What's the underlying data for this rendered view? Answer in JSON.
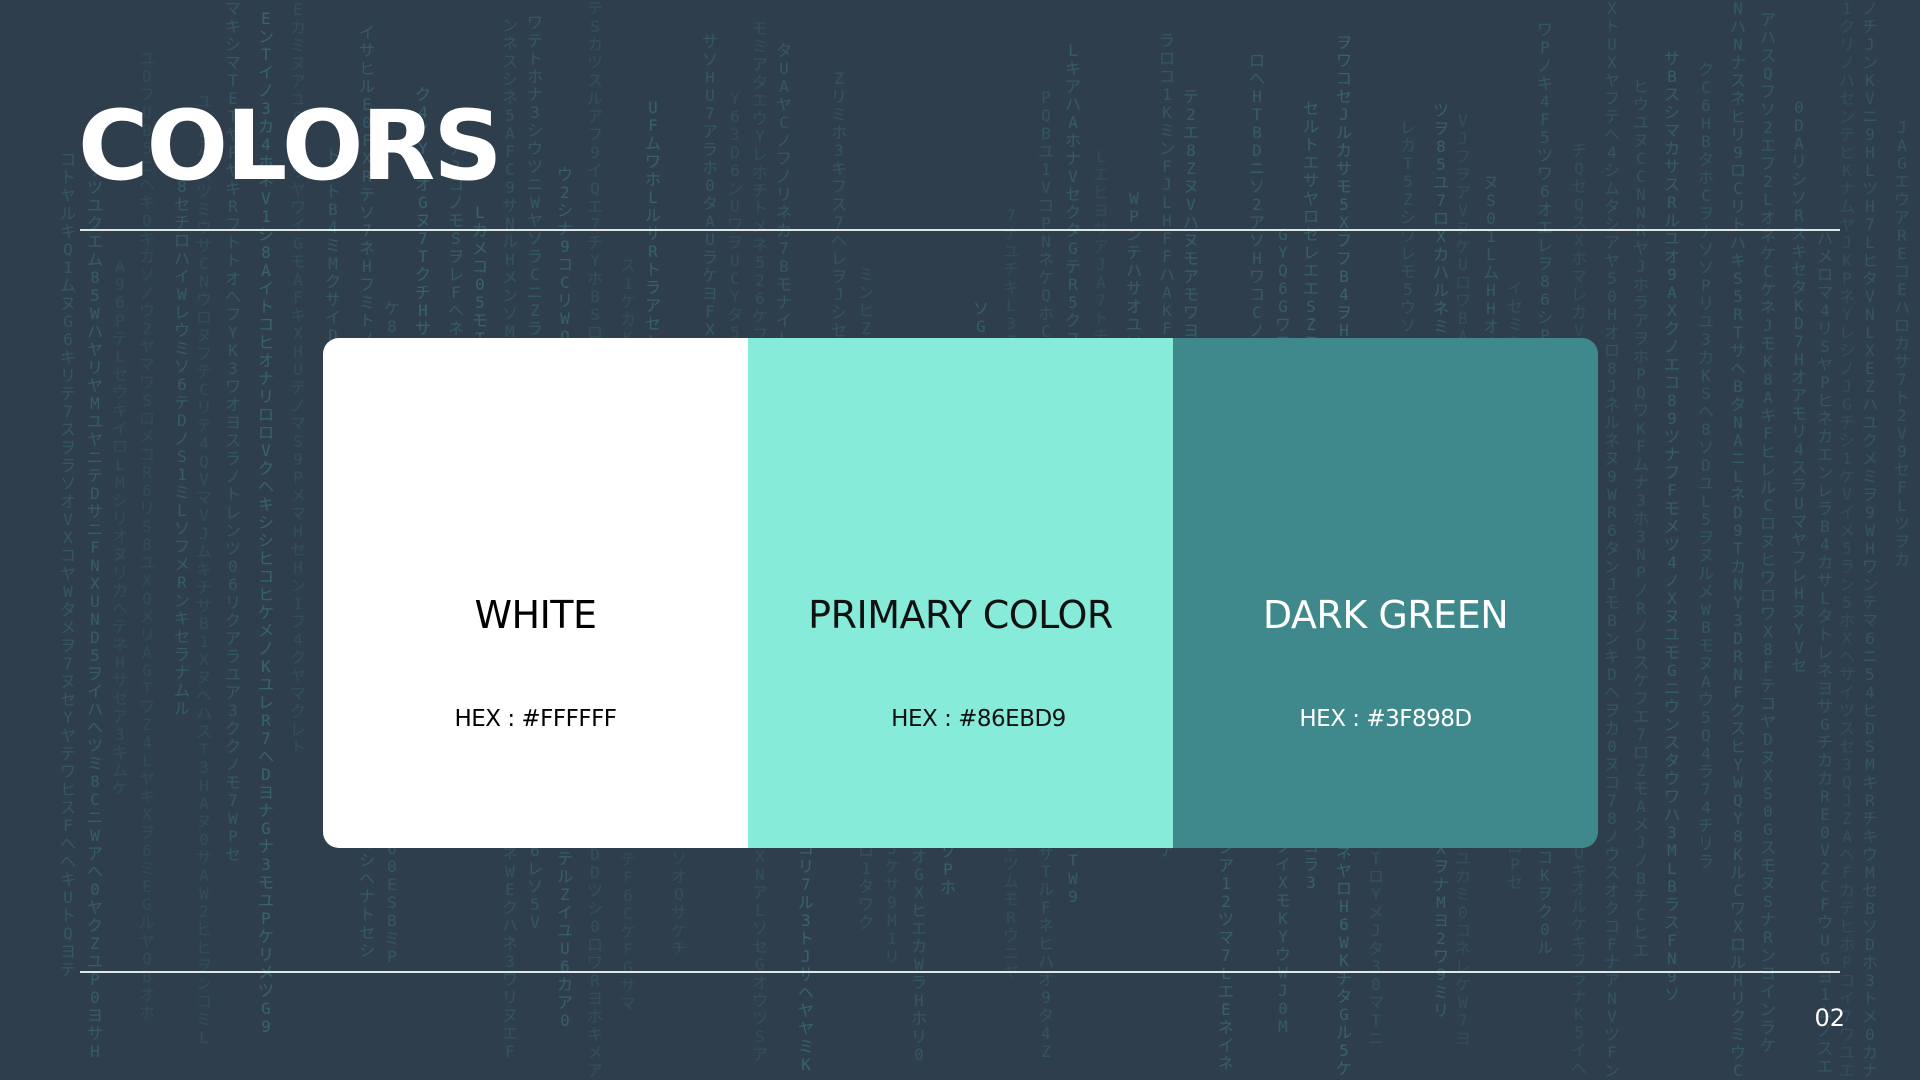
{
  "slide": {
    "title": "COLORS",
    "page_number": "02",
    "background_color": "#2F3E4D",
    "rain_color": "#3F898D"
  },
  "swatches": [
    {
      "name": "WHITE",
      "hex_label": "HEX : #FFFFFF",
      "color": "#FFFFFF",
      "text_color": "#000000"
    },
    {
      "name": "PRIMARY COLOR",
      "hex_label": "HEX : #86EBD9",
      "color": "#86EBD9",
      "text_color": "#111111"
    },
    {
      "name": "DARK GREEN",
      "hex_label": "HEX : #3F898D",
      "color": "#3F898D",
      "text_color": "#FFFFFF"
    }
  ]
}
